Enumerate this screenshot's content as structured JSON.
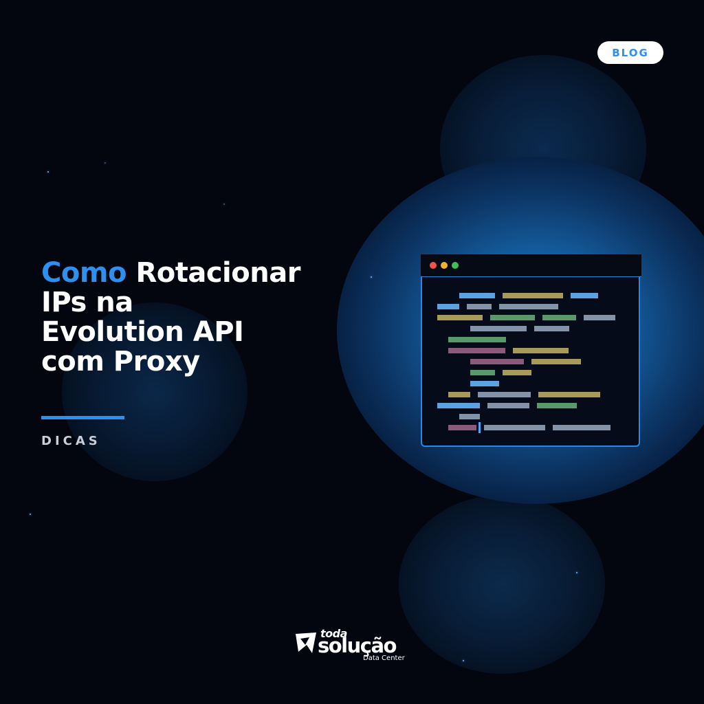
{
  "badge": {
    "label": "BLOG"
  },
  "headline": {
    "accent_word": "Como",
    "line1_rest": "Rotacionar",
    "line2": "IPs na",
    "line3": "Evolution API",
    "line4": "com Proxy"
  },
  "category": {
    "label": "DICAS"
  },
  "logo": {
    "top_word": "toda",
    "main_word": "solução",
    "subtitle": "Data Center"
  },
  "colors": {
    "background": "#03060f",
    "accent": "#2d8ff0",
    "window_border": "#2f86e0",
    "dot_red": "#f0524f",
    "dot_yellow": "#f2b035",
    "dot_green": "#3fbf56"
  },
  "code_window": {
    "icons": [
      "close-dot",
      "minimize-dot",
      "maximize-dot"
    ]
  }
}
